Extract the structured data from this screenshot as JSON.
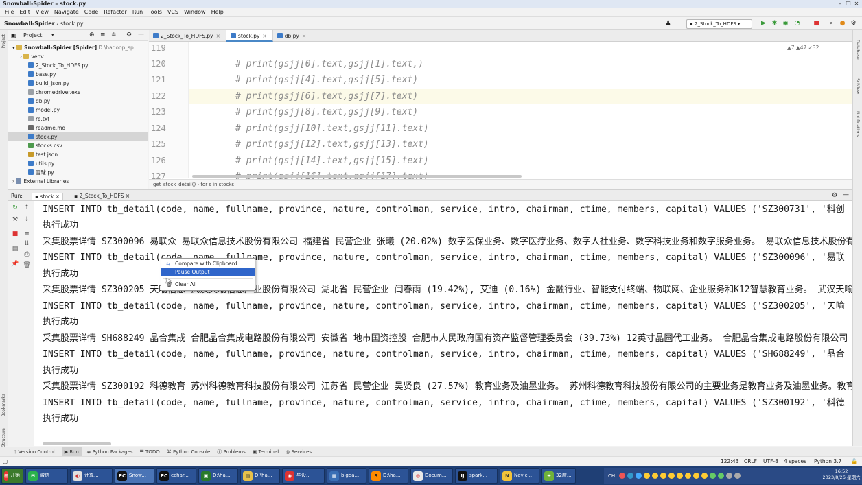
{
  "window": {
    "title": "Snowball-Spider – stock.py"
  },
  "menu": [
    "File",
    "Edit",
    "View",
    "Navigate",
    "Code",
    "Refactor",
    "Run",
    "Tools",
    "VCS",
    "Window",
    "Help"
  ],
  "breadcrumb": {
    "project": "Snowball-Spider",
    "file": "stock.py"
  },
  "toolbar": {
    "run_config": "2_Stock_To_HDFS"
  },
  "left_strip": {
    "project": "Project",
    "bookmarks": "Bookmarks",
    "structure": "Structure"
  },
  "right_strip": {
    "database": "Database",
    "sciview": "SciView",
    "notifications": "Notifications"
  },
  "project_panel": {
    "header": "Project",
    "root": "Snowball-Spider [Spider]",
    "root_path": "D:\\hadoop_sp",
    "items": [
      "venv",
      "2_Stock_To_HDFS.py",
      "base.py",
      "build_json.py",
      "chromedriver.exe",
      "db.py",
      "model.py",
      "re.txt",
      "readme.md",
      "stock.py",
      "stocks.csv",
      "test.json",
      "utils.py",
      "雪球.py"
    ],
    "external": "External Libraries"
  },
  "editor": {
    "tabs": [
      {
        "label": "2_Stock_To_HDFS.py"
      },
      {
        "label": "stock.py"
      },
      {
        "label": "db.py"
      }
    ],
    "inspections": "▲7  ▲47  ✓32",
    "lines": [
      {
        "num": "119",
        "code": ""
      },
      {
        "num": "120",
        "code": "# print(gsjj[0].text,gsjj[1].text,)"
      },
      {
        "num": "121",
        "code": "# print(gsjj[4].text,gsjj[5].text)"
      },
      {
        "num": "122",
        "code": "# print(gsjj[6].text,gsjj[7].text)"
      },
      {
        "num": "123",
        "code": "# print(gsjj[8].text,gsjj[9].text)"
      },
      {
        "num": "124",
        "code": "# print(gsjj[10].text,gsjj[11].text)"
      },
      {
        "num": "125",
        "code": "# print(gsjj[12].text,gsjj[13].text)"
      },
      {
        "num": "126",
        "code": "# print(gsjj[14].text,gsjj[15].text)"
      },
      {
        "num": "127",
        "code": "# print(gsjj[16].text,gsjj[17].text)"
      }
    ],
    "footer": "get_stock_detail()  ›  for s in stocks"
  },
  "run": {
    "label": "Run:",
    "tabs": [
      "stock",
      "2_Stock_To_HDFS"
    ],
    "lines": [
      "INSERT INTO tb_detail(code, name, fullname, province, nature, controlman, service, intro, chairman, ctime, members, capital)  VALUES ('SZ300731', '科创",
      "执行成功",
      "采集股票详情 SZ300096 易联众 易联众信息技术股份有限公司 福建省 民营企业 张曦 (20.02%) 数字医保业务、数字医疗业务、数字人社业务、数字科技业务和数字服务业务。 易联众信息技术股份有",
      "INSERT INTO tb_detail(code, name, fullname, province, nature, controlman, service, intro, chairman, ctime, members, capital)  VALUES ('SZ300096', '易联",
      "执行成功",
      "采集股票详情 SZ300205 天喻信息 武汉天喻信息产业股份有限公司 湖北省 民营企业 闫春雨 (19.42%), 艾迪 (0.16%) 金融行业、智能支付终端、物联网、企业服务和K12智慧教育业务。 武汉天喻",
      "INSERT INTO tb_detail(code, name, fullname, province, nature, controlman, service, intro, chairman, ctime, members, capital)  VALUES ('SZ300205', '天喻",
      "执行成功",
      "采集股票详情 SH688249 晶合集成 合肥晶合集成电路股份有限公司 安徽省 地市国资控股 合肥市人民政府国有资产监督管理委员会 (39.73%) 12英寸晶圆代工业务。 合肥晶合集成电路股份有限公司",
      "INSERT INTO tb_detail(code, name, fullname, province, nature, controlman, service, intro, chairman, ctime, members, capital)  VALUES ('SH688249', '晶合",
      "执行成功",
      "采集股票详情 SZ300192 科德教育 苏州科德教育科技股份有限公司 江苏省 民营企业 吴贤良 (27.57%) 教育业务及油墨业务。 苏州科德教育科技股份有限公司的主要业务是教育业务及油墨业务。教育",
      "INSERT INTO tb_detail(code, name, fullname, province, nature, controlman, service, intro, chairman, ctime, members, capital)  VALUES ('SZ300192', '科德",
      "执行成功"
    ]
  },
  "context_menu": [
    "Compare with Clipboard",
    "Pause Output",
    "Clear All"
  ],
  "bottom_tools": [
    "Version Control",
    "Run",
    "Python Packages",
    "TODO",
    "Python Console",
    "Problems",
    "Terminal",
    "Services"
  ],
  "status": {
    "position": "122:43",
    "line_sep": "CRLF",
    "encoding": "UTF-8",
    "indent": "4 spaces",
    "interpreter": "Python 3.7"
  },
  "taskbar": {
    "start": "开始",
    "tasks": [
      "微信",
      "计算...",
      "Snow...",
      "echar...",
      "D:\\ha...",
      "D:\\ha...",
      "毕设...",
      "bigda...",
      "D:\\ha...",
      "Docum...",
      "spark...",
      "Navic...",
      "32度..."
    ],
    "lang": "CH",
    "time": "16:52",
    "date": "2023/8/26 星期六"
  }
}
